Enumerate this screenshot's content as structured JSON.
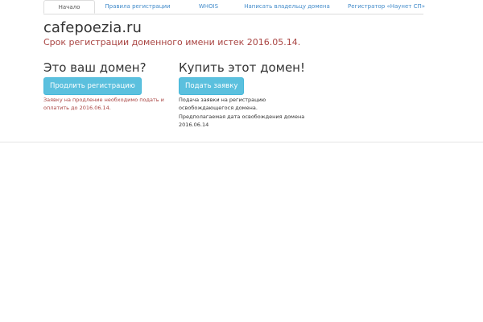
{
  "tabs": [
    {
      "label": "Начало",
      "active": true
    },
    {
      "label": "Правила регистрации",
      "active": false
    },
    {
      "label": "WHOIS",
      "active": false
    },
    {
      "label": "Написать владельцу домена",
      "active": false
    },
    {
      "label": "Регистратор «Наунет СП»",
      "active": false
    }
  ],
  "header": {
    "domain": "cafepoezia.ru",
    "expired_note": "Срок регистрации доменного имени истек 2016.05.14."
  },
  "owner_column": {
    "heading": "Это ваш домен?",
    "button_label": "Продлить регистрацию",
    "note": "Заявку на продление необходимо подать и оплатить до 2016.06.14."
  },
  "buy_column": {
    "heading": "Купить этот домен!",
    "button_label": "Подать заявку",
    "note": "Подача заявки на регистрацию освобождающегося домена.",
    "release_label": "Предполагаемая дата освобождения домена",
    "release_date": "2016.06.14"
  },
  "colors": {
    "link": "#428bca",
    "alert": "#a94442",
    "button": "#5bc0de"
  }
}
